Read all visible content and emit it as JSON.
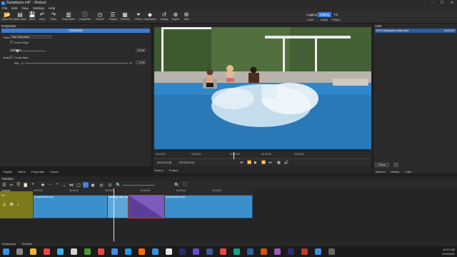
{
  "window": {
    "title": "Samplepro.mlt* - Shotcut"
  },
  "menu": [
    "File",
    "Edit",
    "View",
    "Settings",
    "Help"
  ],
  "toolbar": [
    {
      "label": "Open File",
      "icon": "folder-open-icon",
      "glyph": "📂"
    },
    {
      "label": "Open Other",
      "icon": "open-other-icon",
      "glyph": "▤"
    },
    {
      "label": "Save",
      "icon": "save-icon",
      "glyph": "💾"
    },
    {
      "label": "Undo",
      "icon": "undo-icon",
      "glyph": "↶"
    },
    {
      "label": "Redo",
      "icon": "redo-icon",
      "glyph": "↷"
    },
    {
      "label": "Peak Meter",
      "icon": "peak-meter-icon",
      "glyph": "▥"
    },
    {
      "label": "Properties",
      "icon": "properties-icon",
      "glyph": "ⓘ"
    },
    {
      "label": "Recent",
      "icon": "recent-icon",
      "glyph": "◷"
    },
    {
      "label": "Playlist",
      "icon": "playlist-icon",
      "glyph": "☰"
    },
    {
      "label": "Timeline",
      "icon": "timeline-icon",
      "glyph": "▦"
    },
    {
      "label": "Filters",
      "icon": "filters-icon",
      "glyph": "⏷"
    },
    {
      "label": "Keyframes",
      "icon": "keyframes-icon",
      "glyph": "◆"
    },
    {
      "label": "History",
      "icon": "history-icon",
      "glyph": "↺"
    },
    {
      "label": "Export",
      "icon": "export-icon",
      "glyph": "⊕"
    },
    {
      "label": "Jobs",
      "icon": "jobs-icon",
      "glyph": "⚙"
    }
  ],
  "layouts": {
    "tabs": [
      "Logging",
      "Editing",
      "FX"
    ],
    "active": "Editing",
    "sub": [
      "Color",
      "Audio",
      "Player"
    ]
  },
  "properties": {
    "header": "Properties",
    "section": "Transition",
    "video_label": "Video",
    "video_value": "Bar Horizontal",
    "invert_wipe": "Invert Wipe",
    "softness_label": "Softness",
    "softness_value": "20 %",
    "softness_level": 0.2,
    "audio_label": "Audio",
    "cross_fade": "Cross-fade",
    "mix_label": "Mix:",
    "mix_a": "A",
    "mix_b": "B",
    "mix_value": "0 %"
  },
  "player": {
    "ruler_ticks": [
      "00:00:00",
      "00:00:01",
      "00:00:02",
      "00:00:03",
      "00:00:04"
    ],
    "position": "00:00:02:08",
    "duration": "/ 00:00:04:24",
    "tabs": [
      "Source",
      "Project"
    ]
  },
  "jobs": {
    "header": "Jobs",
    "row_name": "D:\\3Sample\\Loader.mp4",
    "row_time": "00:00:07",
    "pause_label": "Pause",
    "tabs": [
      "Recent",
      "History",
      "Jobs"
    ]
  },
  "left_tabs": [
    "Playlist",
    "Filters",
    "Properties",
    "Export"
  ],
  "timeline": {
    "header": "Timeline",
    "output_label": "Output",
    "track_label": "V1",
    "ruler_ticks": [
      "00:00:00",
      "00:00:01",
      "00:00:02",
      "00:00:03",
      "00:00:04",
      "00:00:05"
    ],
    "clips": [
      "Samplevideo.mp4",
      "Hashtag_fake_mp4",
      "Transition",
      "Samplevideo.mp4"
    ]
  },
  "bottom_tabs": [
    "Keyframes",
    "Timeline"
  ],
  "taskbar": {
    "time": "10:12 AM",
    "date": "4/12/2021"
  }
}
